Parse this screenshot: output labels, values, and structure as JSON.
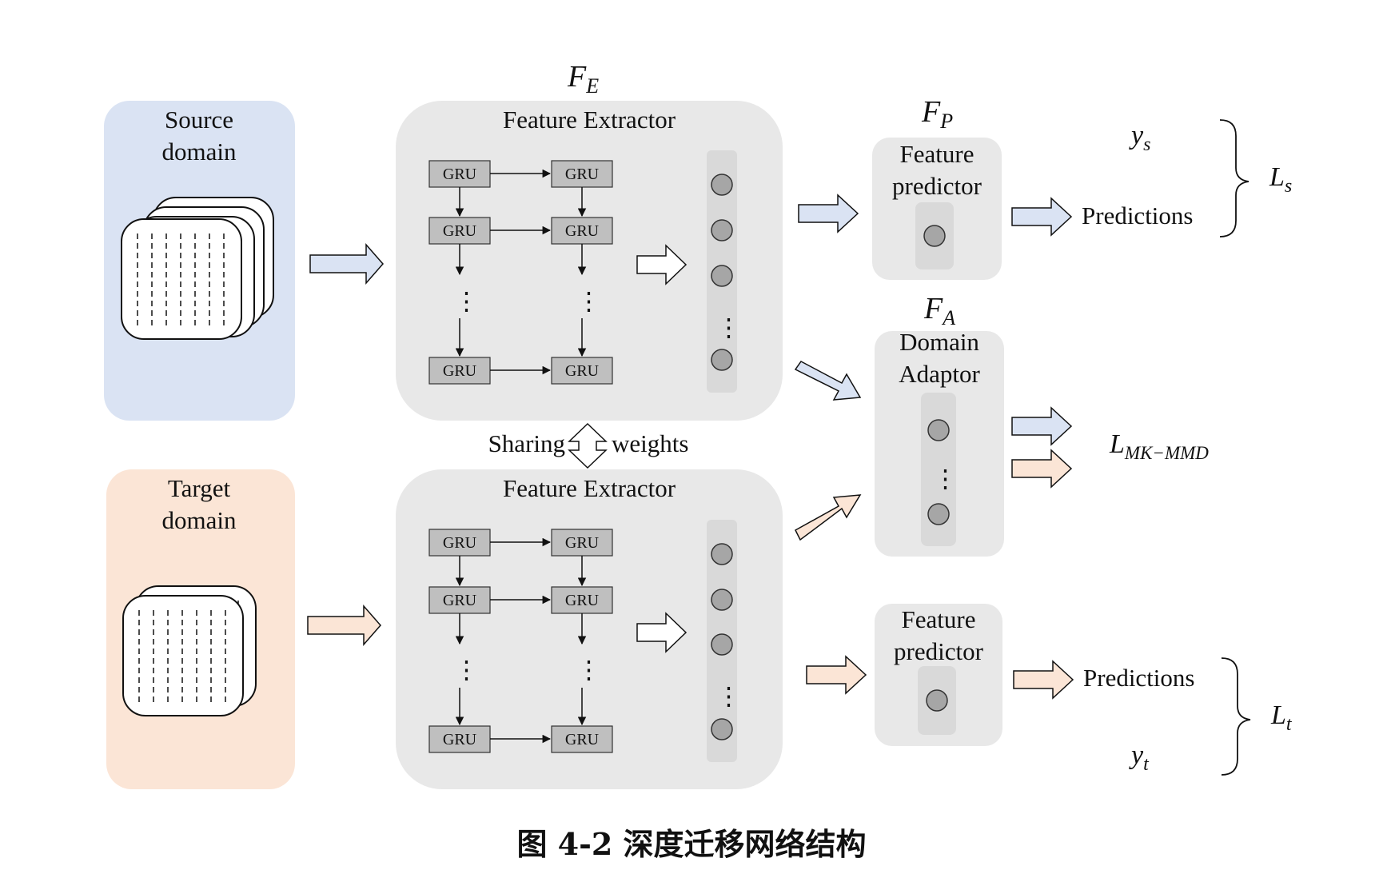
{
  "source_panel": {
    "title_line1": "Source",
    "title_line2": "domain"
  },
  "target_panel": {
    "title_line1": "Target",
    "title_line2": "domain"
  },
  "extractor": {
    "symbol": "F",
    "symbol_sub": "E",
    "title": "Feature Extractor",
    "gru_label": "GRU",
    "vdots": "⋮"
  },
  "sharing": {
    "left": "Sharing",
    "right": "weights"
  },
  "predictor_top": {
    "symbol": "F",
    "symbol_sub": "P",
    "line1": "Feature",
    "line2": "predictor"
  },
  "adaptor": {
    "symbol": "F",
    "symbol_sub": "A",
    "line1": "Domain",
    "line2": "Adaptor"
  },
  "predictor_bottom": {
    "line1": "Feature",
    "line2": "predictor"
  },
  "outputs": {
    "predictions_top": "Predictions",
    "predictions_bottom": "Predictions",
    "ys": "y",
    "ys_sub": "s",
    "yt": "y",
    "yt_sub": "t",
    "loss_s": "L",
    "loss_s_sub": "s",
    "loss_mmd": "L",
    "loss_mmd_sub": "MK−MMD",
    "loss_t": "L",
    "loss_t_sub": "t"
  },
  "caption": "图 4-2 深度迁移网络结构",
  "colors": {
    "source_bg": "#dae3f3",
    "target_bg": "#fbe5d6",
    "panel_bg": "#e8e8e8",
    "column_bg": "#d9d9d9",
    "gru_fill": "#bfbfbf",
    "node_fill": "#a6a6a6",
    "arrow_blue": "#dae3f3",
    "arrow_peach": "#fbe5d6"
  }
}
